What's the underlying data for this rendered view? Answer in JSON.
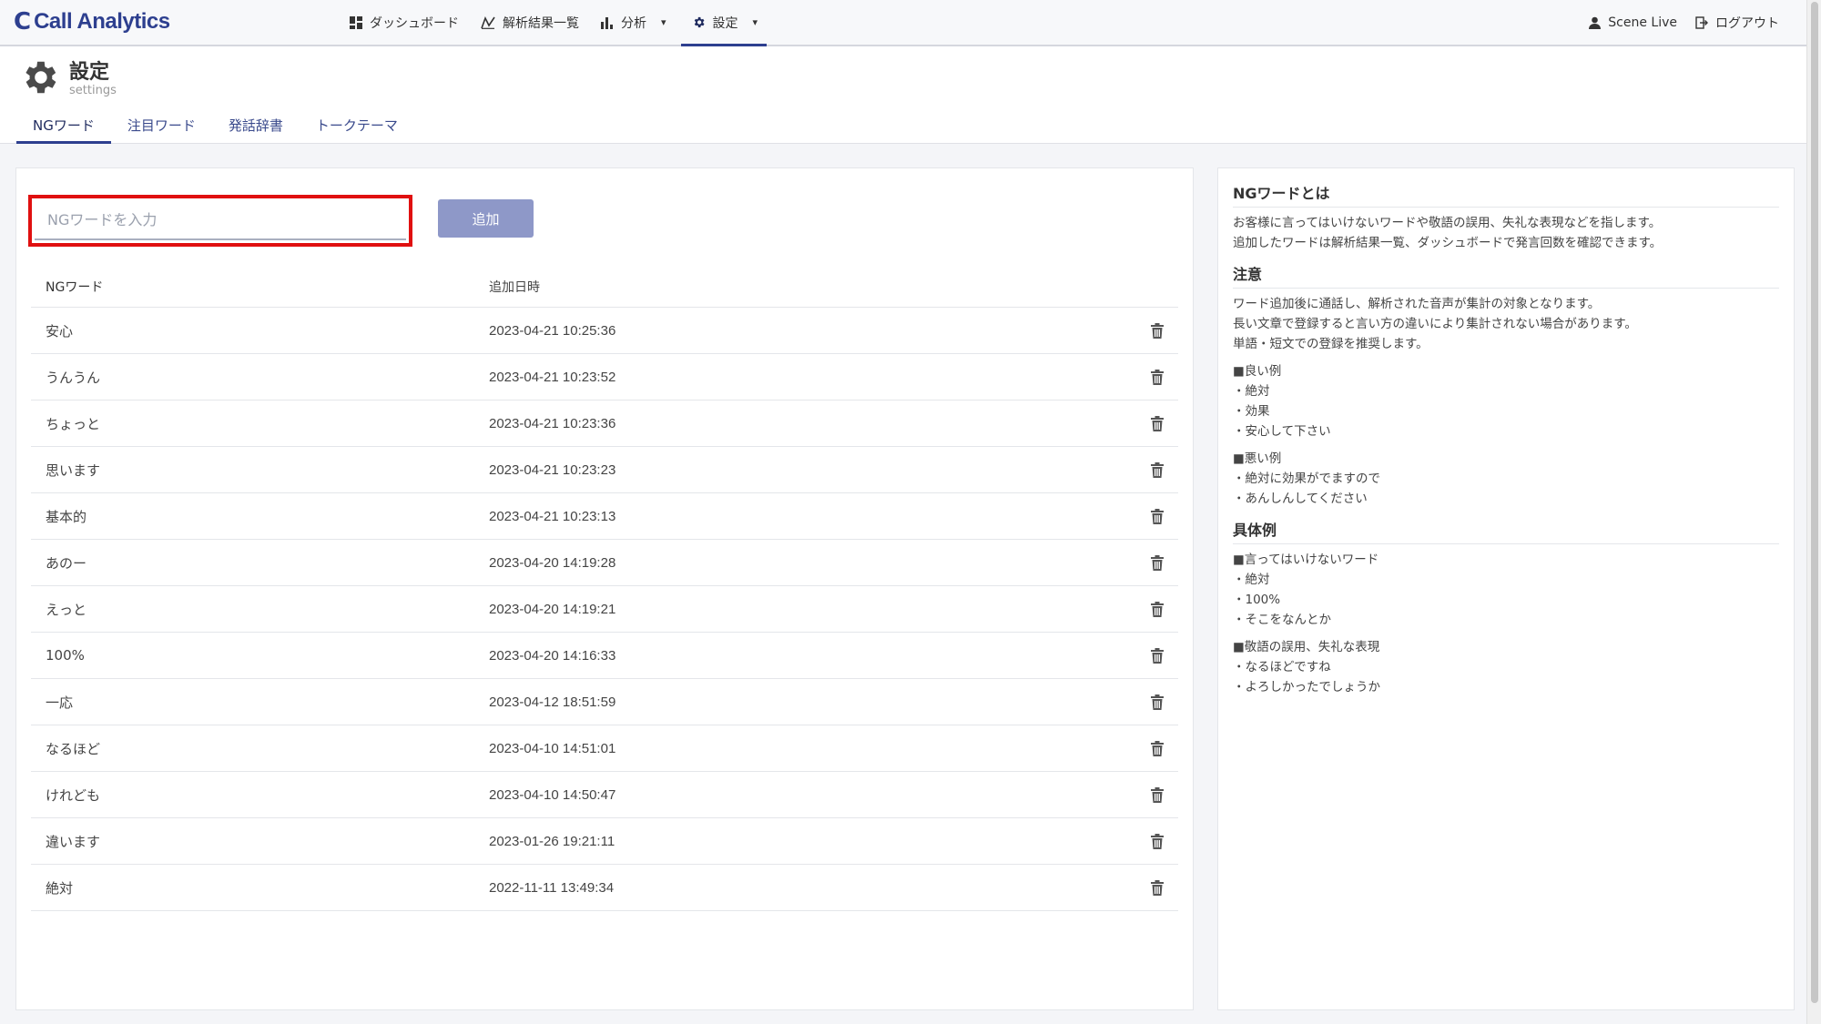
{
  "app": {
    "logo_mark": "C",
    "title": "Call Analytics"
  },
  "nav": {
    "dashboard": "ダッシュボード",
    "results": "解析結果一覧",
    "analysis": "分析",
    "settings": "設定",
    "caret": "▾"
  },
  "user": {
    "name": "Scene Live",
    "logout": "ログアウト"
  },
  "page": {
    "title": "設定",
    "subtitle": "settings"
  },
  "tabs": [
    {
      "label": "NGワード",
      "active": true
    },
    {
      "label": "注目ワード",
      "active": false
    },
    {
      "label": "発話辞書",
      "active": false
    },
    {
      "label": "トークテーマ",
      "active": false
    }
  ],
  "form": {
    "placeholder": "NGワードを入力",
    "value": "",
    "add_label": "追加"
  },
  "table": {
    "columns": [
      "NGワード",
      "追加日時"
    ],
    "rows": [
      {
        "word": "安心",
        "date": "2023-04-21 10:25:36"
      },
      {
        "word": "うんうん",
        "date": "2023-04-21 10:23:52"
      },
      {
        "word": "ちょっと",
        "date": "2023-04-21 10:23:36"
      },
      {
        "word": "思います",
        "date": "2023-04-21 10:23:23"
      },
      {
        "word": "基本的",
        "date": "2023-04-21 10:23:13"
      },
      {
        "word": "あのー",
        "date": "2023-04-20 14:19:28"
      },
      {
        "word": "えっと",
        "date": "2023-04-20 14:19:21"
      },
      {
        "word": "100%",
        "date": "2023-04-20 14:16:33"
      },
      {
        "word": "一応",
        "date": "2023-04-12 18:51:59"
      },
      {
        "word": "なるほど",
        "date": "2023-04-10 14:51:01"
      },
      {
        "word": "けれども",
        "date": "2023-04-10 14:50:47"
      },
      {
        "word": "違います",
        "date": "2023-01-26 19:21:11"
      },
      {
        "word": "絶対",
        "date": "2022-11-11 13:49:34"
      }
    ]
  },
  "help": {
    "what_title": "NGワードとは",
    "what_lines": [
      "お客様に言ってはいけないワードや敬語の誤用、失礼な表現などを指します。",
      "追加したワードは解析結果一覧、ダッシュボードで発言回数を確認できます。"
    ],
    "note_title": "注意",
    "note_lines": [
      "ワード追加後に通話し、解析された音声が集計の対象となります。",
      "長い文章で登録すると言い方の違いにより集計されない場合があります。",
      "単語・短文での登録を推奨します。"
    ],
    "good_lines": [
      "■良い例",
      "・絶対",
      "・効果",
      "・安心して下さい"
    ],
    "bad_lines": [
      "■悪い例",
      "・絶対に効果がでますので",
      "・あんしんしてください"
    ],
    "example_title": "具体例",
    "ex1_lines": [
      "■言ってはいけないワード",
      "・絶対",
      "・100%",
      "・そこをなんとか"
    ],
    "ex2_lines": [
      "■敬語の誤用、失礼な表現",
      "・なるほどですね",
      "・よろしかったでしょうか"
    ]
  },
  "colors": {
    "brand": "#2d3f8f",
    "button": "#8e98c8",
    "highlight": "#e01010"
  }
}
